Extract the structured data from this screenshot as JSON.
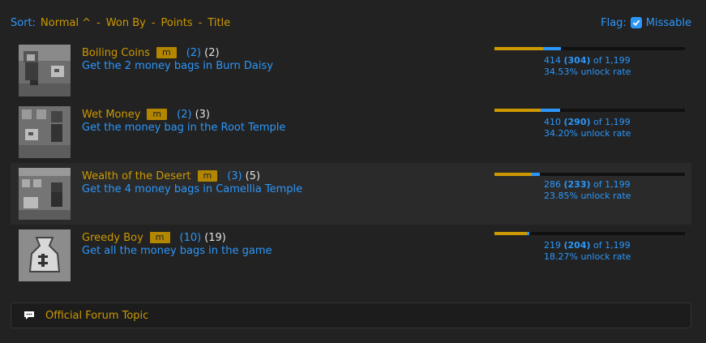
{
  "sort": {
    "label": "Sort:",
    "options": [
      "Normal ^",
      "Won By",
      "Points",
      "Title"
    ],
    "separator": "-"
  },
  "flag": {
    "label": "Flag:",
    "checked": true,
    "option": "Missable"
  },
  "achievements": [
    {
      "title": "Boiling Coins",
      "tag": "m",
      "points": "(2)",
      "retro_points": "(2)",
      "description": "Get the 2 money bags in Burn Daisy",
      "hardcore_fraction": 0.2535,
      "softcore_fraction": 0.0918,
      "count_total": "414",
      "count_hardcore": "(304)",
      "of_text": "of 1,199",
      "unlock_rate": "34.53% unlock rate",
      "icon": "achievement-badge-image"
    },
    {
      "title": "Wet Money",
      "tag": "m",
      "points": "(2)",
      "retro_points": "(3)",
      "description": "Get the money bag in the Root Temple",
      "hardcore_fraction": 0.2419,
      "softcore_fraction": 0.1001,
      "count_total": "410",
      "count_hardcore": "(290)",
      "of_text": "of 1,199",
      "unlock_rate": "34.20% unlock rate",
      "icon": "achievement-badge-image"
    },
    {
      "title": "Wealth of the Desert",
      "tag": "m",
      "points": "(3)",
      "retro_points": "(5)",
      "description": "Get the 4 money bags in Camellia Temple",
      "hardcore_fraction": 0.1943,
      "softcore_fraction": 0.0442,
      "count_total": "286",
      "count_hardcore": "(233)",
      "of_text": "of 1,199",
      "unlock_rate": "23.85% unlock rate",
      "icon": "achievement-badge-image"
    },
    {
      "title": "Greedy Boy",
      "tag": "m",
      "points": "(10)",
      "retro_points": "(19)",
      "description": "Get all the money bags in the game",
      "hardcore_fraction": 0.1701,
      "softcore_fraction": 0.0125,
      "count_total": "219",
      "count_hardcore": "(204)",
      "of_text": "of 1,199",
      "unlock_rate": "18.27% unlock rate",
      "icon": "achievement-badge-image"
    }
  ],
  "forum": {
    "icon": "chat-bubble-icon",
    "label": "Official Forum Topic"
  },
  "colors": {
    "background": "#222222",
    "gold": "#cc9900",
    "blue": "#2c97fa",
    "alt_row": "#2a2a2a"
  }
}
